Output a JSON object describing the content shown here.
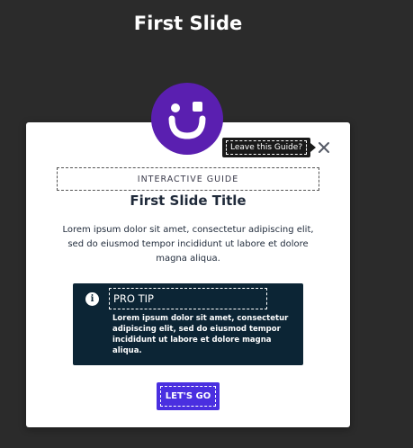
{
  "page": {
    "title": "First Slide"
  },
  "tooltip": {
    "text": "Leave this Guide?"
  },
  "modal": {
    "eyebrow": "INTERACTIVE GUIDE",
    "title": "First Slide Title",
    "body": "Lorem ipsum dolor sit amet, consectetur adipiscing elit, sed do eiusmod tempor incididunt ut labore et dolore magna aliqua.",
    "tip": {
      "icon": "info-icon",
      "title": "PRO TIP",
      "text": "Lorem ipsum dolor sit amet, consectetur adipiscing elit, sed do eiusmod tempor incididunt ut labore et dolore magna aliqua."
    },
    "cta": "LET'S GO"
  },
  "colors": {
    "background": "#2b2b2b",
    "brand_purple": "#5a1fb0",
    "tip_background": "#0c2535",
    "button": "#4a2fe0"
  }
}
